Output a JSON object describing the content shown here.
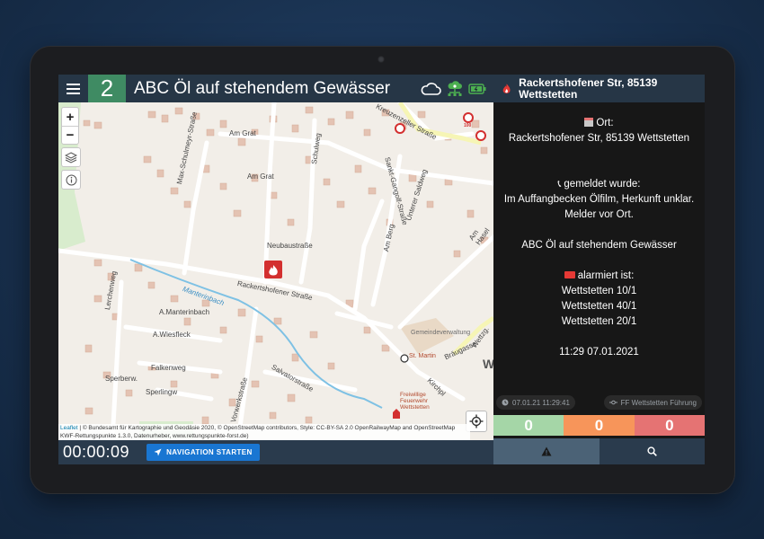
{
  "header": {
    "unit_number": "2",
    "title": "ABC Öl auf stehendem Gewässer",
    "icons": [
      "cloud-icon",
      "network-status-icon",
      "battery-icon"
    ]
  },
  "map": {
    "streets": [
      "Am Grat",
      "Am Grat",
      "Max-Schulmeyr-Straße",
      "Schulweg",
      "Neubaustraße",
      "Rackertshofener Straße",
      "Manterinbach",
      "A.Manterinbach",
      "A.Wiesfleck",
      "Falkenweg",
      "Sperlingw",
      "Sperberw.",
      "Lerchenweg",
      "Salvatorstraße",
      "Vorwerkstraße",
      "Am Berg",
      "Unterer Saldweg",
      "Sankt-Gangolf-Straße",
      "Am Hasel",
      "Bräugasse",
      "Wettzg.",
      "Kirchpl",
      "Gemeindeverwaltung",
      "St. Martin",
      "Freiwillige Feuerwehr Wettstetten",
      "Kreuzenzeller Straße",
      "W"
    ],
    "speed_limit": "100",
    "attribution": {
      "leaflet": "Leaflet",
      "line1": " | © Bundesamt für Kartographie und Geodäsie 2020, © OpenStreetMap contributors, Style: CC-BY-SA 2.0 OpenRailwayMap and OpenStreetMap",
      "line2": "KWF-Rettungspunkte 1.3.0, Datenurheber, www.rettungspunkte-forst.de)"
    }
  },
  "bottom": {
    "timer": "00:00:09",
    "nav_button": "NAVIGATION STARTEN"
  },
  "panel": {
    "address": "Rackertshofener Str, 85139 Wettstetten",
    "ort_label": "Ort:",
    "ort_value": "Rackertshofener Str, 85139 Wettstetten",
    "gemeldet_label": "gemeldet wurde:",
    "gemeldet_lines": [
      "Im Auffangbecken Ölfilm, Herkunft unklar.",
      "Melder vor Ort."
    ],
    "stichwort": "ABC Öl auf stehendem Gewässer",
    "alarmiert_label": "alarmiert ist:",
    "units": [
      "Wettstetten 10/1",
      "Wettstetten 40/1",
      "Wettstetten 20/1"
    ],
    "time": "11:29 07.01.2021",
    "chip_time": "07.01.21 11:29:41",
    "chip_unit": "FF Wettstetten Führung",
    "counts": [
      "0",
      "0",
      "0"
    ],
    "colors": {
      "count_green": "#a5d6a7",
      "count_orange": "#f7955a",
      "count_red": "#e57373",
      "accent": "#3f8b63"
    }
  }
}
